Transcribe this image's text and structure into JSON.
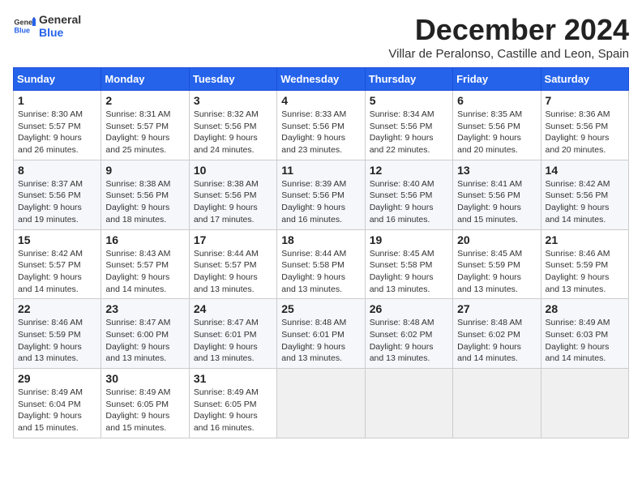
{
  "header": {
    "logo_general": "General",
    "logo_blue": "Blue",
    "month_title": "December 2024",
    "subtitle": "Villar de Peralonso, Castille and Leon, Spain"
  },
  "calendar": {
    "days_of_week": [
      "Sunday",
      "Monday",
      "Tuesday",
      "Wednesday",
      "Thursday",
      "Friday",
      "Saturday"
    ],
    "weeks": [
      [
        {
          "day": "1",
          "sunrise": "8:30 AM",
          "sunset": "5:57 PM",
          "daylight": "9 hours and 26 minutes."
        },
        {
          "day": "2",
          "sunrise": "8:31 AM",
          "sunset": "5:57 PM",
          "daylight": "9 hours and 25 minutes."
        },
        {
          "day": "3",
          "sunrise": "8:32 AM",
          "sunset": "5:56 PM",
          "daylight": "9 hours and 24 minutes."
        },
        {
          "day": "4",
          "sunrise": "8:33 AM",
          "sunset": "5:56 PM",
          "daylight": "9 hours and 23 minutes."
        },
        {
          "day": "5",
          "sunrise": "8:34 AM",
          "sunset": "5:56 PM",
          "daylight": "9 hours and 22 minutes."
        },
        {
          "day": "6",
          "sunrise": "8:35 AM",
          "sunset": "5:56 PM",
          "daylight": "9 hours and 20 minutes."
        },
        {
          "day": "7",
          "sunrise": "8:36 AM",
          "sunset": "5:56 PM",
          "daylight": "9 hours and 20 minutes."
        }
      ],
      [
        {
          "day": "8",
          "sunrise": "8:37 AM",
          "sunset": "5:56 PM",
          "daylight": "9 hours and 19 minutes."
        },
        {
          "day": "9",
          "sunrise": "8:38 AM",
          "sunset": "5:56 PM",
          "daylight": "9 hours and 18 minutes."
        },
        {
          "day": "10",
          "sunrise": "8:38 AM",
          "sunset": "5:56 PM",
          "daylight": "9 hours and 17 minutes."
        },
        {
          "day": "11",
          "sunrise": "8:39 AM",
          "sunset": "5:56 PM",
          "daylight": "9 hours and 16 minutes."
        },
        {
          "day": "12",
          "sunrise": "8:40 AM",
          "sunset": "5:56 PM",
          "daylight": "9 hours and 16 minutes."
        },
        {
          "day": "13",
          "sunrise": "8:41 AM",
          "sunset": "5:56 PM",
          "daylight": "9 hours and 15 minutes."
        },
        {
          "day": "14",
          "sunrise": "8:42 AM",
          "sunset": "5:56 PM",
          "daylight": "9 hours and 14 minutes."
        }
      ],
      [
        {
          "day": "15",
          "sunrise": "8:42 AM",
          "sunset": "5:57 PM",
          "daylight": "9 hours and 14 minutes."
        },
        {
          "day": "16",
          "sunrise": "8:43 AM",
          "sunset": "5:57 PM",
          "daylight": "9 hours and 14 minutes."
        },
        {
          "day": "17",
          "sunrise": "8:44 AM",
          "sunset": "5:57 PM",
          "daylight": "9 hours and 13 minutes."
        },
        {
          "day": "18",
          "sunrise": "8:44 AM",
          "sunset": "5:58 PM",
          "daylight": "9 hours and 13 minutes."
        },
        {
          "day": "19",
          "sunrise": "8:45 AM",
          "sunset": "5:58 PM",
          "daylight": "9 hours and 13 minutes."
        },
        {
          "day": "20",
          "sunrise": "8:45 AM",
          "sunset": "5:59 PM",
          "daylight": "9 hours and 13 minutes."
        },
        {
          "day": "21",
          "sunrise": "8:46 AM",
          "sunset": "5:59 PM",
          "daylight": "9 hours and 13 minutes."
        }
      ],
      [
        {
          "day": "22",
          "sunrise": "8:46 AM",
          "sunset": "5:59 PM",
          "daylight": "9 hours and 13 minutes."
        },
        {
          "day": "23",
          "sunrise": "8:47 AM",
          "sunset": "6:00 PM",
          "daylight": "9 hours and 13 minutes."
        },
        {
          "day": "24",
          "sunrise": "8:47 AM",
          "sunset": "6:01 PM",
          "daylight": "9 hours and 13 minutes."
        },
        {
          "day": "25",
          "sunrise": "8:48 AM",
          "sunset": "6:01 PM",
          "daylight": "9 hours and 13 minutes."
        },
        {
          "day": "26",
          "sunrise": "8:48 AM",
          "sunset": "6:02 PM",
          "daylight": "9 hours and 13 minutes."
        },
        {
          "day": "27",
          "sunrise": "8:48 AM",
          "sunset": "6:02 PM",
          "daylight": "9 hours and 14 minutes."
        },
        {
          "day": "28",
          "sunrise": "8:49 AM",
          "sunset": "6:03 PM",
          "daylight": "9 hours and 14 minutes."
        }
      ],
      [
        {
          "day": "29",
          "sunrise": "8:49 AM",
          "sunset": "6:04 PM",
          "daylight": "9 hours and 15 minutes."
        },
        {
          "day": "30",
          "sunrise": "8:49 AM",
          "sunset": "6:05 PM",
          "daylight": "9 hours and 15 minutes."
        },
        {
          "day": "31",
          "sunrise": "8:49 AM",
          "sunset": "6:05 PM",
          "daylight": "9 hours and 16 minutes."
        },
        null,
        null,
        null,
        null
      ]
    ]
  }
}
